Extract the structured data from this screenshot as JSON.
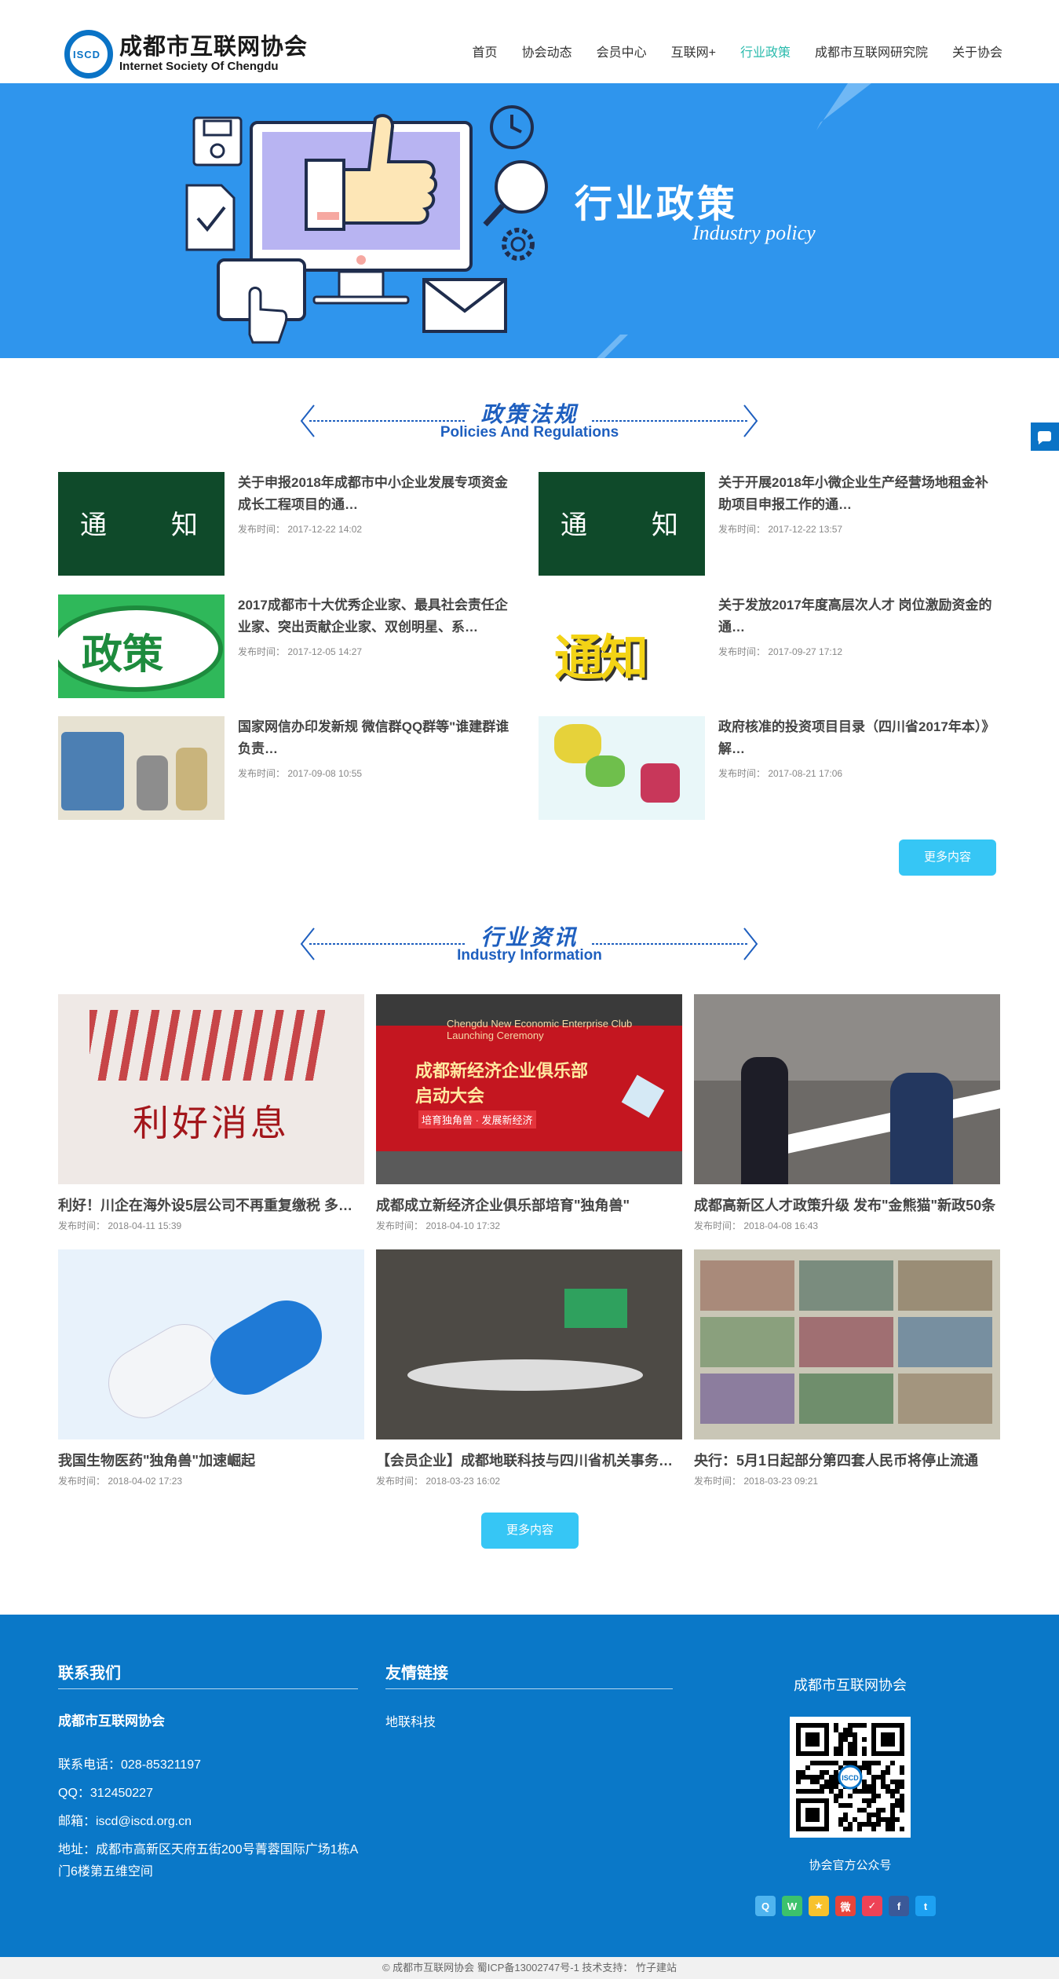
{
  "header": {
    "logo_mark": "ISCD",
    "logo_cn": "成都市互联网协会",
    "logo_en": "Internet Society Of Chengdu",
    "nav": [
      {
        "label": "首页"
      },
      {
        "label": "协会动态"
      },
      {
        "label": "会员中心"
      },
      {
        "label": "互联网+"
      },
      {
        "label": "行业政策"
      },
      {
        "label": "成都市互联网研究院"
      },
      {
        "label": "关于协会"
      }
    ],
    "active_index": 4
  },
  "banner": {
    "title": "行业政策",
    "subtitle": "Industry policy"
  },
  "policy": {
    "title_cn": "政策法规",
    "title_en": "Policies And Regulations",
    "more_label": "更多内容",
    "items": [
      {
        "title": "关于申报2018年成都市中小企业发展专项资金成长工程项目的通…",
        "date": "发布时间： 2017-12-22 14:02",
        "thumb": "通知-green"
      },
      {
        "title": "关于开展2018年小微企业生产经营场地租金补助项目申报工作的通…",
        "date": "发布时间： 2017-12-22 13:57",
        "thumb": "通知-green"
      },
      {
        "title": "2017成都市十大优秀企业家、最具社会责任企业家、突出贡献企业家、双创明星、系…",
        "date": "发布时间： 2017-12-05 14:27",
        "thumb": "政策"
      },
      {
        "title": "关于发放2017年度高层次人才 岗位激励资金的通…",
        "date": "发布时间： 2017-09-27 17:12",
        "thumb": "通知-yellow"
      },
      {
        "title": "国家网信办印发新规 微信群QQ群等\"谁建群谁负责…",
        "date": "发布时间： 2017-09-08 10:55",
        "thumb": "cartoon"
      },
      {
        "title": "政府核准的投资项目目录（四川省2017年本）》解…",
        "date": "发布时间： 2017-08-21 17:06",
        "thumb": "cartoon2"
      }
    ],
    "thumb_text_a": "通",
    "thumb_text_b": "知",
    "thumb_policy": "政策",
    "thumb_notice": "通知"
  },
  "info": {
    "title_cn": "行业资讯",
    "title_en": "Industry Information",
    "more_label": "更多内容",
    "items": [
      {
        "title": "利好！川企在海外设5层公司不再重复缴税 多…",
        "date": "发布时间： 2018-04-11 15:39"
      },
      {
        "title": "成都成立新经济企业俱乐部培育\"独角兽\"",
        "date": "发布时间： 2018-04-10 17:32"
      },
      {
        "title": "成都高新区人才政策升级 发布\"金熊猫\"新政50条",
        "date": "发布时间： 2018-04-08 16:43"
      },
      {
        "title": "我国生物医药\"独角兽\"加速崛起",
        "date": "发布时间： 2018-04-02 17:23"
      },
      {
        "title": "【会员企业】成都地联科技与四川省机关事务…",
        "date": "发布时间： 2018-03-23 16:02"
      },
      {
        "title": "央行：5月1日起部分第四套人民币将停止流通",
        "date": "发布时间： 2018-03-23 09:21"
      }
    ],
    "img1_text": "利好消息",
    "img2_text_a": "成都新经济企业俱乐部",
    "img2_text_b": "启动大会",
    "img2_text_c": "培育独角兽 · 发展新经济",
    "img2_text_en": "Chengdu New Economic Enterprise Club Launching Ceremony"
  },
  "footer": {
    "contact_head": "联系我们",
    "org_name": "成都市互联网协会",
    "phone": "联系电话：028-85321197",
    "qq": "QQ：312450227",
    "email": "邮箱：iscd@iscd.org.cn",
    "address": "地址：成都市高新区天府五街200号菁蓉国际广场1栋A门6楼第五维空间",
    "links_head": "友情链接",
    "link1": "地联科技",
    "qr_title": "成都市互联网协会",
    "qr_caption": "协会官方公众号",
    "qr_center": "ISCD",
    "social": [
      {
        "name": "qq-icon",
        "color": "#4fb4ef",
        "glyph": "Q"
      },
      {
        "name": "wechat-icon",
        "color": "#3cc26c",
        "glyph": "W"
      },
      {
        "name": "qzone-icon",
        "color": "#f7c22d",
        "glyph": "★"
      },
      {
        "name": "weibo-icon",
        "color": "#e8443b",
        "glyph": "微"
      },
      {
        "name": "pocket-icon",
        "color": "#ee4256",
        "glyph": "✓"
      },
      {
        "name": "facebook-icon",
        "color": "#3b5998",
        "glyph": "f"
      },
      {
        "name": "twitter-icon",
        "color": "#1da1f2",
        "glyph": "t"
      }
    ]
  },
  "copyright": "© 成都市互联网协会   蜀ICP备13002747号-1   技术支持： 竹子建站",
  "colors": {
    "accent": "#2bbbad",
    "banner": "#2f95ed",
    "footer": "#0a78c8",
    "button": "#36c6f5",
    "title_blue": "#1e5fbf"
  }
}
